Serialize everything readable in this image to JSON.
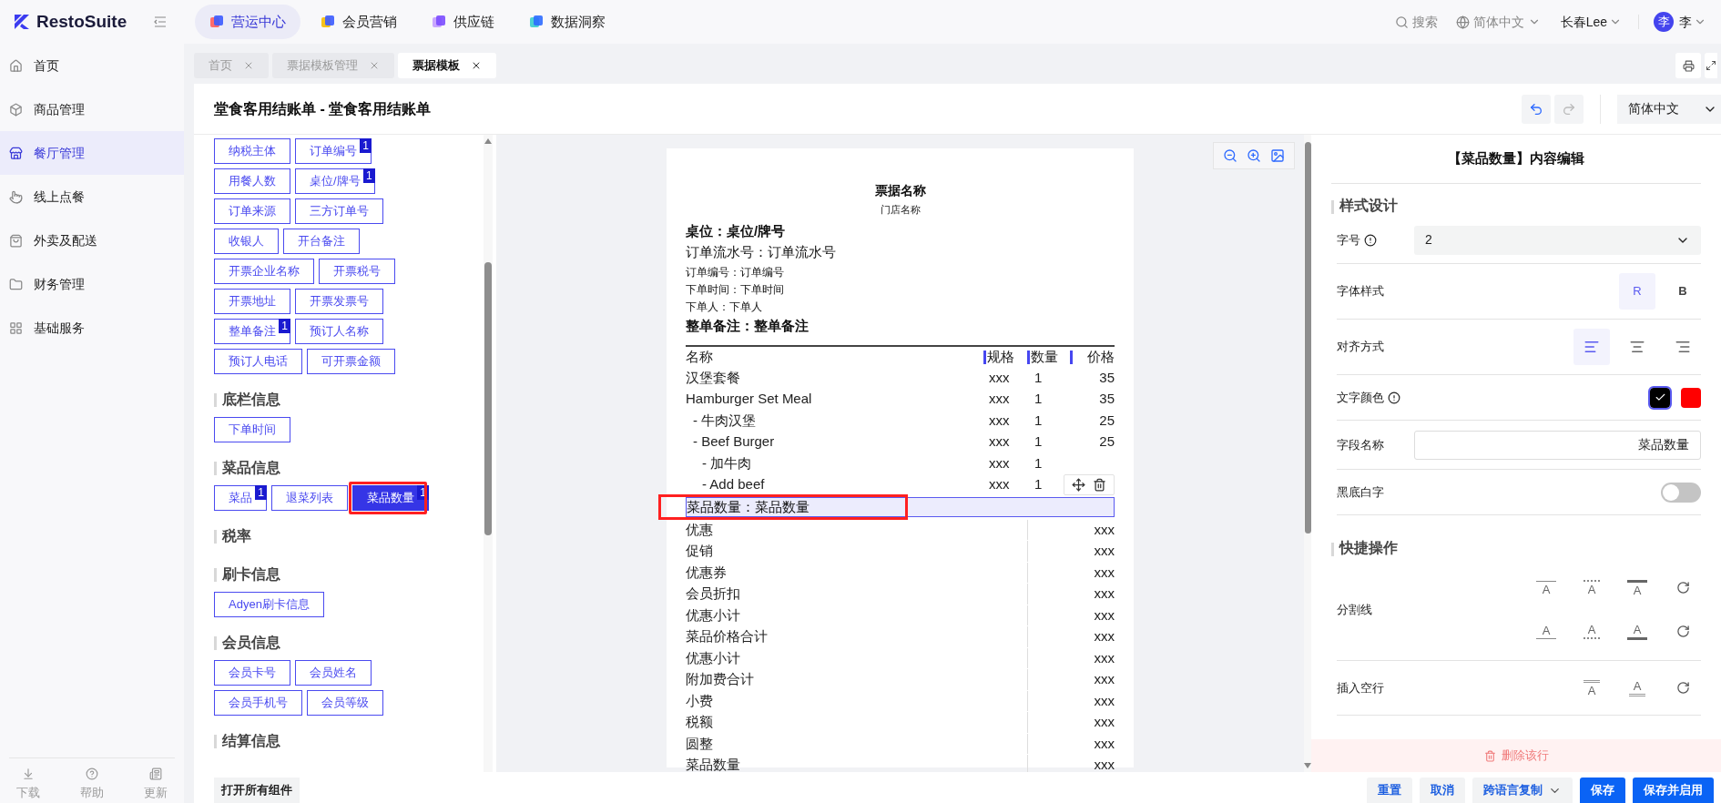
{
  "header": {
    "logo": "RestoSuite",
    "nav": [
      {
        "label": "营运中心",
        "selected": true
      },
      {
        "label": "会员营销",
        "selected": false
      },
      {
        "label": "供应链",
        "selected": false
      },
      {
        "label": "数据洞察",
        "selected": false
      }
    ],
    "search": "搜索",
    "language": "简体中文",
    "store": "长春Lee",
    "avatar": "李",
    "user": "李"
  },
  "sidebar": {
    "items": [
      {
        "label": "首页",
        "selected": false
      },
      {
        "label": "商品管理",
        "selected": false
      },
      {
        "label": "餐厅管理",
        "selected": true
      },
      {
        "label": "线上点餐",
        "selected": false
      },
      {
        "label": "外卖及配送",
        "selected": false
      },
      {
        "label": "财务管理",
        "selected": false
      },
      {
        "label": "基础服务",
        "selected": false
      }
    ],
    "footer": [
      "下载",
      "帮助",
      "更新"
    ]
  },
  "tabs": [
    {
      "label": "首页",
      "selected": false
    },
    {
      "label": "票据模板管理",
      "selected": false
    },
    {
      "label": "票据模板",
      "selected": true
    }
  ],
  "page": {
    "title": "堂食客用结账单 - 堂食客用结账单",
    "language": "简体中文"
  },
  "components": {
    "groups": [
      {
        "rows": [
          [
            {
              "label": "纳税主体",
              "selected": false
            },
            {
              "label": "订单编号",
              "badge": "1",
              "selected": false
            }
          ],
          [
            {
              "label": "用餐人数",
              "selected": false
            },
            {
              "label": "桌位/牌号",
              "badge": "1",
              "selected": false
            }
          ],
          [
            {
              "label": "订单来源",
              "selected": false
            },
            {
              "label": "三方订单号",
              "selected": false
            }
          ],
          [
            {
              "label": "收银人",
              "selected": false
            },
            {
              "label": "开台备注",
              "selected": false
            }
          ],
          [
            {
              "label": "开票企业名称",
              "selected": false
            },
            {
              "label": "开票税号",
              "selected": false
            }
          ],
          [
            {
              "label": "开票地址",
              "selected": false
            },
            {
              "label": "开票发票号",
              "selected": false
            }
          ],
          [
            {
              "label": "整单备注",
              "badge": "1",
              "selected": false
            },
            {
              "label": "预订人名称",
              "selected": false
            }
          ],
          [
            {
              "label": "预订人电话",
              "selected": false
            },
            {
              "label": "可开票金额",
              "selected": false
            }
          ]
        ]
      },
      {
        "title": "底栏信息",
        "rows": [
          [
            {
              "label": "下单时间",
              "selected": false
            }
          ]
        ]
      },
      {
        "title": "菜品信息",
        "rows": [
          [
            {
              "label": "菜品",
              "badge": "1",
              "selected": false
            },
            {
              "label": "退菜列表",
              "selected": false
            },
            {
              "label": "菜品数量",
              "badge": "1",
              "selected": true
            }
          ]
        ]
      },
      {
        "title": "税率"
      },
      {
        "title": "刷卡信息",
        "rows": [
          [
            {
              "label": "Adyen刷卡信息",
              "selected": false
            }
          ]
        ]
      },
      {
        "title": "会员信息",
        "rows": [
          [
            {
              "label": "会员卡号",
              "selected": false
            },
            {
              "label": "会员姓名",
              "selected": false
            }
          ],
          [
            {
              "label": "会员手机号",
              "selected": false
            },
            {
              "label": "会员等级",
              "selected": false
            }
          ]
        ]
      },
      {
        "title": "结算信息"
      }
    ],
    "open_all": "打开所有组件"
  },
  "receipt": {
    "title": "票据名称",
    "store": "门店名称",
    "lines": [
      {
        "text": "桌位：桌位/牌号",
        "kind": "emphasis"
      },
      {
        "text": "订单流水号：订单流水号",
        "kind": "normal"
      },
      {
        "text": "订单编号：订单编号",
        "kind": "detail"
      },
      {
        "text": "下单时间：下单时间",
        "kind": "detail"
      },
      {
        "text": "下单人：下单人",
        "kind": "detail"
      },
      {
        "text": "整单备注：整单备注",
        "kind": "emphasis"
      }
    ],
    "columns": [
      {
        "label": "名称",
        "marker": false
      },
      {
        "label": "规格",
        "marker": true
      },
      {
        "label": "数量",
        "marker": true
      },
      {
        "label": "价格",
        "marker": true
      }
    ],
    "items": [
      {
        "name": "汉堡套餐",
        "spec": "xxx",
        "qty": "1",
        "price": "35"
      },
      {
        "name": "Hamburger Set Meal",
        "spec": "xxx",
        "qty": "1",
        "price": "35",
        "children": [
          {
            "name": "- 牛肉汉堡",
            "spec": "xxx",
            "qty": "1",
            "price": "25"
          },
          {
            "name": "- Beef Burger",
            "spec": "xxx",
            "qty": "1",
            "price": "25",
            "children": [
              {
                "name": "- 加牛肉",
                "spec": "xxx",
                "qty": "1"
              },
              {
                "name": "- Add beef",
                "spec": "xxx",
                "qty": "1"
              }
            ]
          }
        ]
      }
    ],
    "field_rows": [
      {
        "text": "菜品数量：菜品数量",
        "selected": true
      }
    ],
    "summary": [
      {
        "label": "优惠",
        "value": "xxx"
      },
      {
        "label": "促销",
        "value": "xxx"
      },
      {
        "label": "优惠券",
        "value": "xxx"
      },
      {
        "label": "会员折扣",
        "value": "xxx"
      },
      {
        "label": "优惠小计",
        "value": "xxx"
      },
      {
        "label": "菜品价格合计",
        "value": "xxx"
      },
      {
        "label": "优惠小计",
        "value": "xxx"
      },
      {
        "label": "附加费合计",
        "value": "xxx"
      },
      {
        "label": "小费",
        "value": "xxx"
      },
      {
        "label": "税额",
        "value": "xxx"
      },
      {
        "label": "圆整",
        "value": "xxx"
      },
      {
        "label": "菜品数量",
        "value": "xxx"
      }
    ]
  },
  "editor": {
    "title": "【菜品数量】内容编辑",
    "style_section": "样式设计",
    "font_size": {
      "label": "字号",
      "info": true,
      "value": "2"
    },
    "font_style": {
      "label": "字体样式",
      "options": [
        {
          "label": "R",
          "selected": true
        },
        {
          "label": "B",
          "selected": false
        }
      ]
    },
    "align": {
      "label": "对齐方式",
      "options": [
        {
          "kind": "left",
          "selected": true
        },
        {
          "kind": "center",
          "selected": false
        },
        {
          "kind": "right",
          "selected": false
        }
      ]
    },
    "text_color": {
      "label": "文字颜色",
      "info": true,
      "swatches": [
        {
          "color": "#000000",
          "selected": true
        },
        {
          "color": "#ff0000",
          "selected": false
        }
      ]
    },
    "field_name": {
      "label": "字段名称",
      "value": "菜品数量"
    },
    "inverse": {
      "label": "黑底白字",
      "on": false
    },
    "quick_section": "快捷操作",
    "divider": {
      "label": "分割线",
      "rows": [
        [
          {
            "kind": "top-thin",
            "glyph": "A"
          },
          {
            "kind": "top-dotted",
            "glyph": "A"
          },
          {
            "kind": "top-thick",
            "glyph": "A"
          }
        ],
        [
          {
            "kind": "bottom-thin",
            "glyph": "A"
          },
          {
            "kind": "bottom-dotted",
            "glyph": "A"
          },
          {
            "kind": "bottom-thick",
            "glyph": "A"
          }
        ]
      ]
    },
    "blank_line": {
      "label": "插入空行",
      "options": [
        {
          "kind": "blank-above",
          "glyph": "A"
        },
        {
          "kind": "blank-below",
          "glyph": "A"
        }
      ]
    },
    "delete": "删除该行"
  },
  "footer_buttons": [
    {
      "label": "重置",
      "kind": "secondary"
    },
    {
      "label": "取消",
      "kind": "secondary"
    },
    {
      "label": "跨语言复制",
      "kind": "dropdown"
    },
    {
      "label": "保存",
      "kind": "primary"
    },
    {
      "label": "保存并启用",
      "kind": "primary"
    }
  ]
}
